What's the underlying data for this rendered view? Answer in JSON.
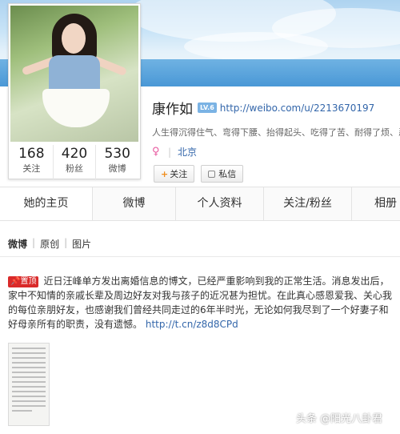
{
  "profile": {
    "name": "康作如",
    "verify_badge": "LV.6",
    "url": "http://weibo.com/u/2213670197",
    "intro": "人生得沉得住气、弯得下腰、抬得起头、吃得了苦、耐得了烦、忍",
    "gender_icon": "♀",
    "location": "北京",
    "follow_button": "关注",
    "message_button": "私信"
  },
  "stats": [
    {
      "num": "168",
      "label": "关注"
    },
    {
      "num": "420",
      "label": "粉丝"
    },
    {
      "num": "530",
      "label": "微博"
    }
  ],
  "tabs": [
    "她的主页",
    "微博",
    "个人资料",
    "关注/粉丝",
    "相册"
  ],
  "subtabs": [
    "微博",
    "原创",
    "图片"
  ],
  "post": {
    "pin_label": "置顶",
    "lines": [
      "近日汪峰单方发出离婚信息的博文，已经严重影响到我的正常生活。消息发出后，",
      "家中不知情的亲戚长辈及周边好友对我与孩子的近况甚为担忧。在此真心感恩爱我、关心我",
      "的每位亲朋好友，也感谢我们曾经共同走过的6年半时光，无论如何我尽到了一个好妻子和",
      "好母亲所有的职责，没有遗憾。"
    ],
    "link": "http://t.cn/z8d8CPd"
  },
  "watermark": "头条 @阳光八卦君",
  "colors": {
    "link": "#3366aa",
    "pin": "#d92a2a",
    "follow_plus": "#f08d1c",
    "gender": "#e85aa0"
  }
}
